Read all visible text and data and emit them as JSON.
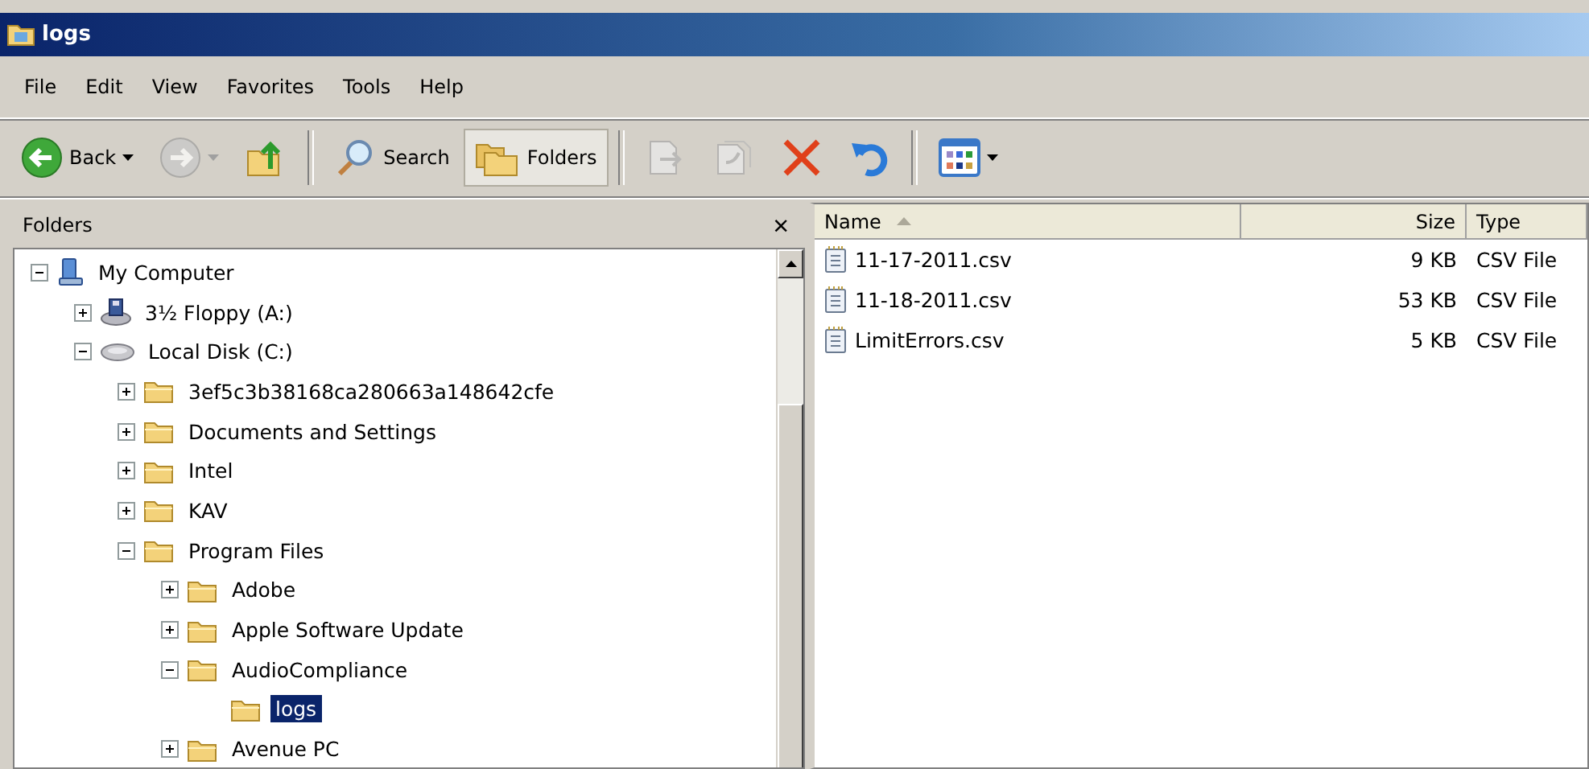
{
  "window": {
    "title": "logs"
  },
  "menu": [
    "File",
    "Edit",
    "View",
    "Favorites",
    "Tools",
    "Help"
  ],
  "toolbar": [
    {
      "kind": "back",
      "label": "Back",
      "dropdown": true,
      "disabled": false,
      "selected": false
    },
    {
      "kind": "forward",
      "dropdown": true,
      "disabled": true,
      "selected": false
    },
    {
      "kind": "up",
      "disabled": false,
      "selected": false
    },
    {
      "kind": "separator"
    },
    {
      "kind": "search",
      "label": "Search",
      "disabled": false,
      "selected": false
    },
    {
      "kind": "folders",
      "label": "Folders",
      "disabled": false,
      "selected": true
    },
    {
      "kind": "separator"
    },
    {
      "kind": "move",
      "disabled": true,
      "selected": false
    },
    {
      "kind": "copy",
      "disabled": true,
      "selected": false
    },
    {
      "kind": "delete",
      "disabled": false,
      "selected": false
    },
    {
      "kind": "undo",
      "disabled": false,
      "selected": false
    },
    {
      "kind": "separator"
    },
    {
      "kind": "views",
      "dropdown": true,
      "disabled": false,
      "selected": false
    }
  ],
  "folders_pane": {
    "title": "Folders",
    "close": "×",
    "tree": [
      {
        "label": "My Computer",
        "kind": "computer",
        "expandable": true,
        "expanded": true,
        "selected": false,
        "children": [
          {
            "label": "3½ Floppy (A:)",
            "kind": "floppy",
            "expandable": true,
            "expanded": false,
            "selected": false
          },
          {
            "label": "Local Disk (C:)",
            "kind": "disk",
            "expandable": true,
            "expanded": true,
            "selected": false,
            "children": [
              {
                "label": "3ef5c3b38168ca280663a148642cfe",
                "kind": "folder",
                "expandable": true,
                "expanded": false,
                "selected": false
              },
              {
                "label": "Documents and Settings",
                "kind": "folder",
                "expandable": true,
                "expanded": false,
                "selected": false
              },
              {
                "label": "Intel",
                "kind": "folder",
                "expandable": true,
                "expanded": false,
                "selected": false
              },
              {
                "label": "KAV",
                "kind": "folder",
                "expandable": true,
                "expanded": false,
                "selected": false
              },
              {
                "label": "Program Files",
                "kind": "folder",
                "expandable": true,
                "expanded": true,
                "selected": false,
                "children": [
                  {
                    "label": "Adobe",
                    "kind": "folder",
                    "expandable": true,
                    "expanded": false,
                    "selected": false
                  },
                  {
                    "label": "Apple Software Update",
                    "kind": "folder",
                    "expandable": true,
                    "expanded": false,
                    "selected": false
                  },
                  {
                    "label": "AudioCompliance",
                    "kind": "folder",
                    "expandable": true,
                    "expanded": true,
                    "selected": false,
                    "children": [
                      {
                        "label": "logs",
                        "kind": "folder",
                        "selected": true
                      }
                    ]
                  },
                  {
                    "label": "Avenue PC",
                    "kind": "folder",
                    "expandable": true,
                    "expanded": false,
                    "selected": false
                  }
                ]
              }
            ]
          }
        ]
      }
    ]
  },
  "file_list": {
    "columns": [
      {
        "label": "Name",
        "sorted": true
      },
      {
        "label": "Size",
        "sorted": false
      },
      {
        "label": "Type",
        "sorted": false
      }
    ],
    "rows": [
      {
        "name": "11-17-2011.csv",
        "size": "9 KB",
        "type": "CSV File"
      },
      {
        "name": "11-18-2011.csv",
        "size": "53 KB",
        "type": "CSV File"
      },
      {
        "name": "LimitErrors.csv",
        "size": "5 KB",
        "type": "CSV File"
      }
    ]
  }
}
